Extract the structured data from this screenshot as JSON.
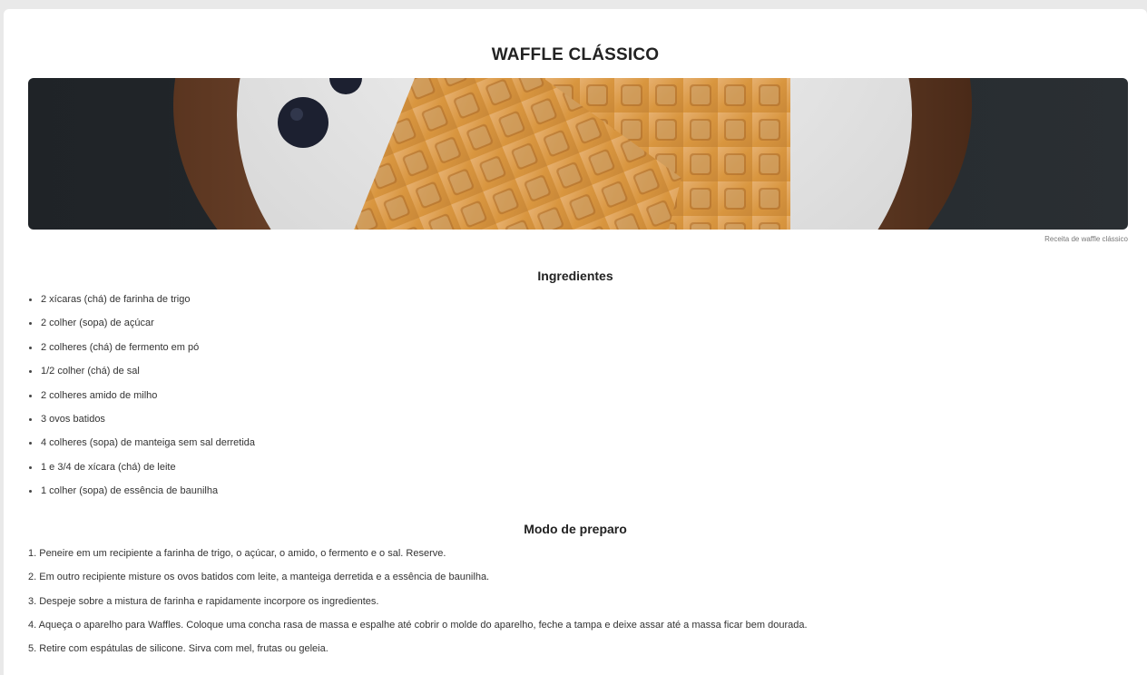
{
  "title": "WAFFLE CLÁSSICO",
  "hero": {
    "caption": "Receita de waffle clássico"
  },
  "ingredients": {
    "heading": "Ingredientes",
    "items": [
      "2 xícaras (chá) de farinha de trigo",
      "2 colher (sopa) de açúcar",
      "2 colheres (chá) de fermento em pó",
      "1/2 colher (chá) de sal",
      "2 colheres amido de milho",
      "3 ovos batidos",
      "4 colheres (sopa) de manteiga sem sal derretida",
      "1 e 3/4 de xícara (chá) de leite",
      "1 colher (sopa) de essência de baunilha"
    ]
  },
  "preparation": {
    "heading": "Modo de preparo",
    "steps": [
      "1. Peneire em um recipiente a farinha de trigo, o açúcar, o amido, o fermento e o sal. Reserve.",
      "2. Em outro recipiente misture os ovos batidos com leite, a manteiga derretida e a essência de baunilha.",
      "3. Despeje sobre a mistura de farinha e rapidamente incorpore os ingredientes.",
      "4. Aqueça o aparelho para Waffles. Coloque uma concha rasa de massa e espalhe até cobrir o molde do aparelho, feche a tampa e deixe assar até a massa ficar bem dourada.",
      "5. Retire com espátulas de silicone. Sirva com mel, frutas ou geleia."
    ]
  },
  "colors": {
    "background": "#e9e9e9",
    "card": "#ffffff",
    "text": "#333333",
    "heading": "#222222"
  }
}
